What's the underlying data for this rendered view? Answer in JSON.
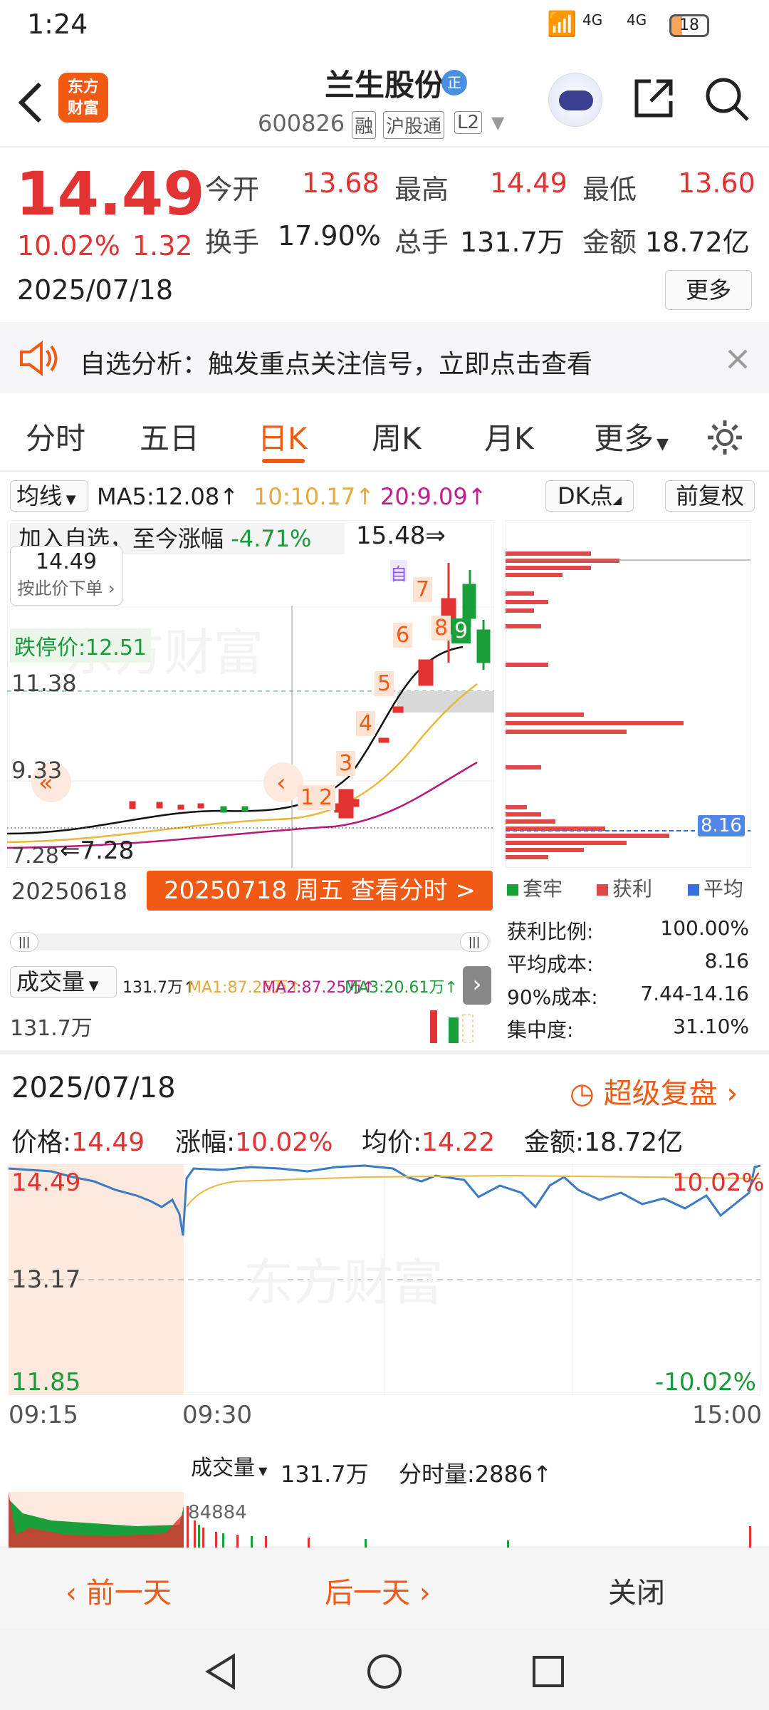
{
  "status_bar": {
    "time": "1:24",
    "battery": "18",
    "net1": "4G",
    "net2": "4G"
  },
  "header": {
    "title": "兰生股份",
    "badge": "正",
    "code": "600826",
    "tags": [
      "融",
      "沪股通",
      "L2"
    ]
  },
  "quote": {
    "price": "14.49",
    "change_pct": "10.02%",
    "change_amt": "1.32",
    "date": "2025/07/18",
    "stats": [
      {
        "label": "今开",
        "value": "13.68"
      },
      {
        "label": "最高",
        "value": "14.49"
      },
      {
        "label": "最低",
        "value": "13.60"
      }
    ],
    "stats2": [
      {
        "label": "换手",
        "value": "17.90%"
      },
      {
        "label": "总手",
        "value": "131.7万"
      },
      {
        "label": "金额",
        "value": "18.72亿"
      }
    ],
    "more_label": "更多"
  },
  "notice": {
    "text": "自选分析：触发重点关注信号，立即点击查看"
  },
  "tabs": [
    {
      "label": "分时"
    },
    {
      "label": "五日"
    },
    {
      "label": "日K"
    },
    {
      "label": "周K"
    },
    {
      "label": "月K"
    },
    {
      "label": "更多"
    }
  ],
  "kline": {
    "ma_label": "均线",
    "ma5": "MA5:12.08↑",
    "ma10": "10:10.17↑",
    "ma20": "20:9.09↑",
    "dk_label": "DK点",
    "fq_label": "前复权",
    "add_watch": "加入自选，至今涨幅",
    "add_watch_pct": "-4.71%",
    "high_label": "15.48",
    "tip_price": "14.49",
    "tip_text": "按此价下单",
    "limit_down": "跌停价:12.51",
    "y_labels": [
      "11.38",
      "9.33",
      "7.28"
    ],
    "low_label": "7.28",
    "self_label": "自",
    "date_start": "20250618",
    "date_btn": "20250718 周五 查看分时 >",
    "counts": [
      "1",
      "2",
      "3",
      "4",
      "5",
      "6",
      "7",
      "8",
      "9"
    ],
    "vol_label": "成交量",
    "vol_val": "131.7万↑",
    "vol_ma1": "MA1:87.25万↑",
    "vol_ma2": "MA2:87.25万↑",
    "vol_ma3": "MA3:20.61万↑",
    "vol_axis": "131.7万"
  },
  "chips": {
    "avg_label": "8.16",
    "legend": [
      "套牢",
      "获利",
      "平均"
    ],
    "rows": [
      {
        "label": "获利比例:",
        "value": "100.00%"
      },
      {
        "label": "平均成本:",
        "value": "8.16"
      },
      {
        "label": "90%成本:",
        "value": "7.44-14.16"
      },
      {
        "label": "集中度:",
        "value": "31.10%"
      }
    ]
  },
  "intraday": {
    "date": "2025/07/18",
    "replay": "超级复盘",
    "fields": [
      {
        "label": "价格:",
        "value": "14.49"
      },
      {
        "label": "涨幅:",
        "value": "10.02%"
      },
      {
        "label": "均价:",
        "value": "14.22"
      },
      {
        "label": "金额:",
        "value": "18.72亿"
      }
    ],
    "y_top": "14.49",
    "y_mid": "13.17",
    "y_bot": "11.85",
    "pct_top": "10.02%",
    "pct_bot": "-10.02%",
    "times": [
      "09:15",
      "09:30",
      "15:00"
    ],
    "vol_label": "成交量",
    "vol_val": "131.7万",
    "fen_label": "分时量:2886↑",
    "vol_max": "84884"
  },
  "bottom": {
    "prev": "前一天",
    "next": "后一天",
    "close": "关闭"
  },
  "colors": {
    "accent": "#f05a14",
    "up": "#e23232",
    "down": "#1a9a3a"
  }
}
